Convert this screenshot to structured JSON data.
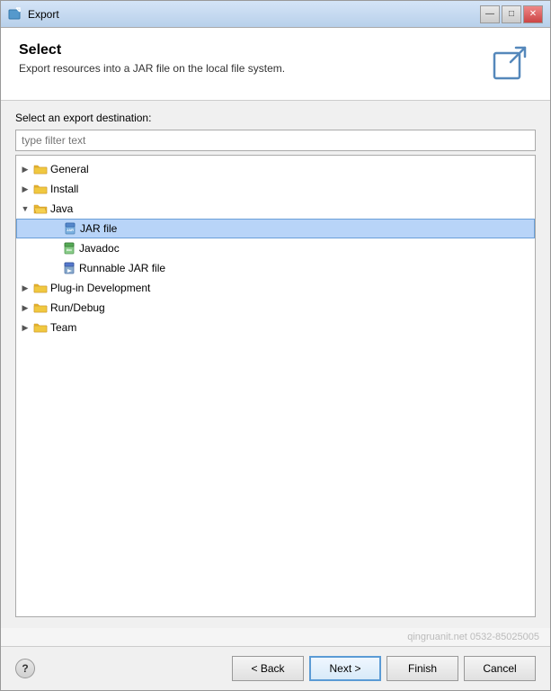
{
  "window": {
    "title": "Export",
    "title_icon": "export"
  },
  "title_buttons": {
    "minimize": "—",
    "maximize": "□",
    "close": "✕"
  },
  "header": {
    "title": "Select",
    "subtitle": "Export resources into a JAR file on the local file system."
  },
  "filter": {
    "placeholder": "type filter text"
  },
  "section_label": "Select an export destination:",
  "tree": {
    "items": [
      {
        "id": "general",
        "label": "General",
        "level": 1,
        "type": "folder-closed",
        "toggle": "▶",
        "expanded": false
      },
      {
        "id": "install",
        "label": "Install",
        "level": 1,
        "type": "folder-closed",
        "toggle": "▶",
        "expanded": false
      },
      {
        "id": "java",
        "label": "Java",
        "level": 1,
        "type": "folder-open",
        "toggle": "▼",
        "expanded": true
      },
      {
        "id": "jar-file",
        "label": "JAR file",
        "level": 2,
        "type": "jar",
        "toggle": "",
        "selected": true
      },
      {
        "id": "javadoc",
        "label": "Javadoc",
        "level": 2,
        "type": "javadoc",
        "toggle": ""
      },
      {
        "id": "runnable-jar",
        "label": "Runnable JAR file",
        "level": 2,
        "type": "runnable-jar",
        "toggle": ""
      },
      {
        "id": "plugin-dev",
        "label": "Plug-in Development",
        "level": 1,
        "type": "folder-closed",
        "toggle": "▶",
        "expanded": false
      },
      {
        "id": "run-debug",
        "label": "Run/Debug",
        "level": 1,
        "type": "folder-closed",
        "toggle": "▶",
        "expanded": false
      },
      {
        "id": "team",
        "label": "Team",
        "level": 1,
        "type": "folder-closed",
        "toggle": "▶",
        "expanded": false
      }
    ]
  },
  "watermark": "qingruanit.net 0532-85025005",
  "footer": {
    "help_label": "?",
    "back_label": "< Back",
    "next_label": "Next >",
    "finish_label": "Finish",
    "cancel_label": "Cancel"
  }
}
